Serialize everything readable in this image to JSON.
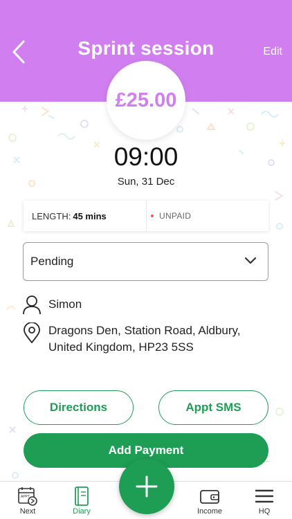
{
  "header": {
    "title": "Sprint session",
    "edit_label": "Edit",
    "back_icon": "chevron-left-icon",
    "background_color": "#d17ff0"
  },
  "price": "£25.00",
  "appointment": {
    "time": "09:00",
    "date": "Sun, 31 Dec",
    "length_label": "LENGTH:",
    "length_value": "45 mins",
    "payment_status": "UNPAID"
  },
  "status_select": {
    "selected": "Pending"
  },
  "client": {
    "name": "Simon",
    "address": "Dragons Den, Station Road, Aldbury, United Kingdom, HP23 5SS"
  },
  "buttons": {
    "directions": "Directions",
    "sms": "Appt SMS",
    "add_payment": "Add Payment"
  },
  "tabbar": {
    "items": [
      {
        "label": "Next",
        "icon": "appt-calendar-icon",
        "active": false
      },
      {
        "label": "Diary",
        "icon": "notebook-icon",
        "active": true
      },
      {
        "label": "Income",
        "icon": "wallet-icon",
        "active": false
      },
      {
        "label": "HQ",
        "icon": "menu-icon",
        "active": false
      }
    ],
    "fab_icon": "plus-icon"
  },
  "colors": {
    "accent_purple": "#d17ff0",
    "accent_green": "#1e9e55"
  }
}
